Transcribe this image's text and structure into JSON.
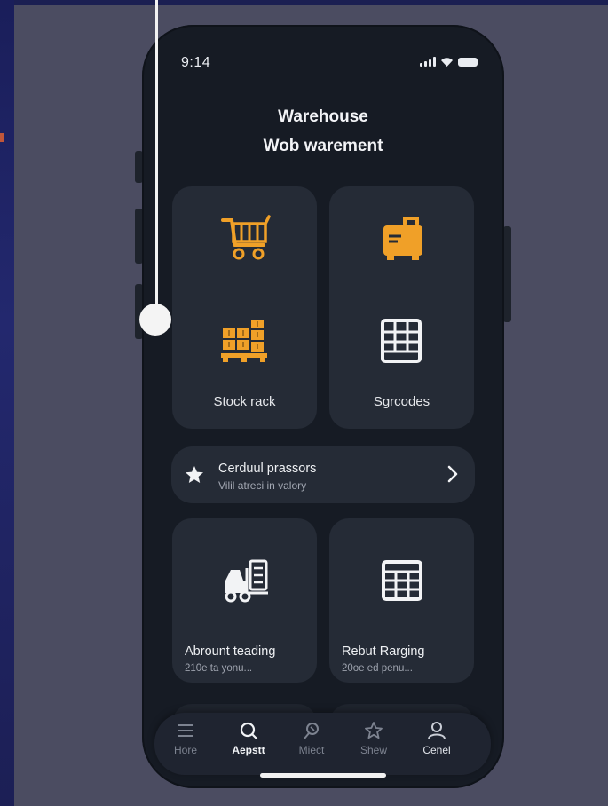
{
  "status_bar": {
    "time": "9:14"
  },
  "header": {
    "line1": "Warehouse",
    "line2": "Wob warement"
  },
  "cards": [
    {
      "label": "Stock rack",
      "icons": [
        "cart-icon",
        "pallet-boxes-icon"
      ]
    },
    {
      "label": "Sgrcodes",
      "icons": [
        "generator-icon",
        "grid-panel-icon"
      ]
    }
  ],
  "promo": {
    "title": "Cerduul prassors",
    "subtitle": "Vilil atreci in valory",
    "icon": "star-icon"
  },
  "small_cards": [
    {
      "title": "Abrount teading",
      "subtitle": "210e ta yonu...",
      "icon": "forklift-icon"
    },
    {
      "title": "Rebut Rarging",
      "subtitle": "20oe ed penu...",
      "icon": "grid-panel-icon"
    }
  ],
  "tabs": [
    {
      "label": "Hore",
      "icon": "menu-icon",
      "active": false
    },
    {
      "label": "Aepstt",
      "icon": "search-icon",
      "active": true
    },
    {
      "label": "Miect",
      "icon": "pin-icon",
      "active": false
    },
    {
      "label": "Shew",
      "icon": "star-icon",
      "active": false
    },
    {
      "label": "Cenel",
      "icon": "user-icon",
      "active": false
    }
  ],
  "colors": {
    "accent": "#f0a028",
    "card": "#252b36",
    "phone": "#161b24",
    "background": "#4b4c61"
  }
}
